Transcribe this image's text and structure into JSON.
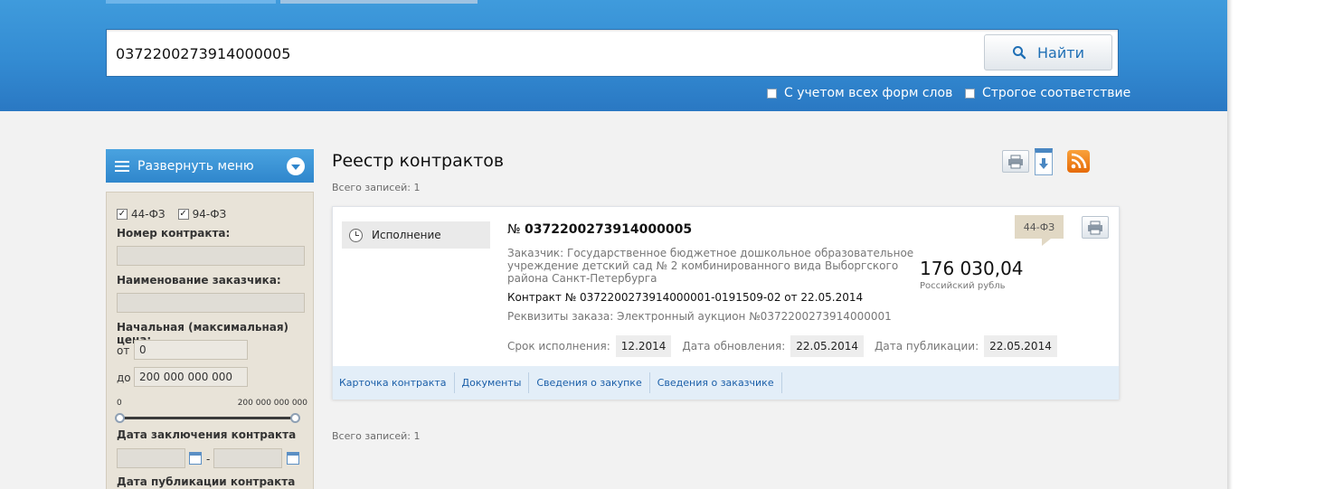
{
  "search": {
    "value": "0372200273914000005",
    "button_label": "Найти",
    "option_word_forms": "С учетом всех форм слов",
    "option_strict": "Строгое соответствие"
  },
  "sidebar": {
    "menu_label": "Развернуть меню",
    "laws": [
      {
        "label": "44-ФЗ",
        "checked": true
      },
      {
        "label": "94-ФЗ",
        "checked": true
      }
    ],
    "contract_number_label": "Номер контракта:",
    "customer_name_label": "Наименование заказчика:",
    "initial_price_label": "Начальная (максимальная) цена:",
    "price_from_prefix": "от",
    "price_from_value": "0",
    "price_to_prefix": "до",
    "price_to_value": "200 000 000 000",
    "scale_min": "0",
    "scale_max": "200 000 000 000",
    "date_signed_label": "Дата заключения контракта",
    "date_separator": "-",
    "date_published_label": "Дата публикации контракта"
  },
  "main": {
    "title": "Реестр контрактов",
    "total_top": "Всего записей: 1",
    "total_bottom": "Всего записей: 1"
  },
  "record": {
    "status": "Исполнение",
    "number_prefix": "№",
    "number": "0372200273914000005",
    "customer": "Заказчик: Государственное бюджетное дошкольное образовательное учреждение детский сад № 2 комбинированного вида Выборгского района Санкт-Петербурга",
    "contract_line": "Контракт № 0372200273914000001-0191509-02 от 22.05.2014",
    "requisites": "Реквизиты заказа: Электронный аукцион №0372200273914000001",
    "execution_label": "Срок исполнения:",
    "execution_value": "12.2014",
    "updated_label": "Дата обновления:",
    "updated_value": "22.05.2014",
    "published_label": "Дата публикации:",
    "published_value": "22.05.2014",
    "price": "176 030,04",
    "currency": "Российский рубль",
    "law_badge": "44-ФЗ",
    "links": [
      "Карточка контракта",
      "Документы",
      "Сведения о закупке",
      "Сведения о заказчике"
    ]
  },
  "icons": {
    "search": "search-icon",
    "print": "printer-icon",
    "download": "download-icon",
    "rss": "rss-icon",
    "clock": "clock-icon",
    "calendar": "calendar-icon"
  },
  "colors": {
    "header_blue": "#338bd2",
    "link_blue": "#1a5ea8",
    "rss_orange": "#f08a1c",
    "filter_bg": "#e8e3d8"
  }
}
